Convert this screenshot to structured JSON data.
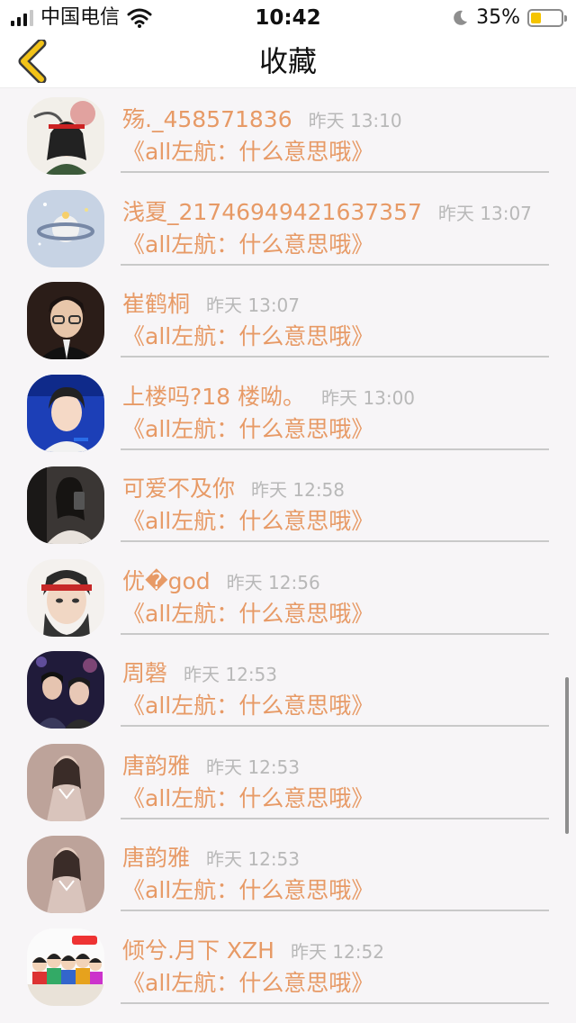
{
  "status_bar": {
    "carrier": "中国电信",
    "time": "10:42",
    "battery_percent": "35%",
    "battery_level": 0.35,
    "battery_color": "#f5c400"
  },
  "nav": {
    "back_icon": "chevron-left-icon",
    "title": "收藏",
    "back_icon_color": "#f2c318"
  },
  "colors": {
    "accent": "#e79a66",
    "timestamp": "#b8b8b8"
  },
  "favorites": [
    {
      "name": "殇._458571836",
      "time": "昨天 13:10",
      "message": "《all左航：什么意思哦》",
      "avatar": "avatar-ink-warrior"
    },
    {
      "name": "浅夏_21746949421637357",
      "time": "昨天 13:07",
      "message": "《all左航：什么意思哦》",
      "avatar": "avatar-planet"
    },
    {
      "name": "崔鹤桐",
      "time": "昨天 13:07",
      "message": "《all左航：什么意思哦》",
      "avatar": "avatar-boy-glasses"
    },
    {
      "name": "上楼吗?18 楼呦。",
      "time": "昨天 13:00",
      "message": "《all左航：什么意思哦》",
      "avatar": "avatar-boy-blue"
    },
    {
      "name": "可爱不及你",
      "time": "昨天 12:58",
      "message": "《all左航：什么意思哦》",
      "avatar": "avatar-mirror-selfie"
    },
    {
      "name": "优�god",
      "time": "昨天 12:56",
      "message": "《all左航：什么意思哦》",
      "avatar": "avatar-anime-headband"
    },
    {
      "name": "周磬",
      "time": "昨天 12:53",
      "message": "《all左航：什么意思哦》",
      "avatar": "avatar-stage-duo"
    },
    {
      "name": "唐韵雅",
      "time": "昨天 12:53",
      "message": "《all左航：什么意思哦》",
      "avatar": "avatar-girl-dress"
    },
    {
      "name": "唐韵雅",
      "time": "昨天 12:53",
      "message": "《all左航：什么意思哦》",
      "avatar": "avatar-girl-dress"
    },
    {
      "name": "倾兮.月下 XZH",
      "time": "昨天 12:52",
      "message": "《all左航：什么意思哦》",
      "avatar": "avatar-cartoon-group"
    }
  ]
}
